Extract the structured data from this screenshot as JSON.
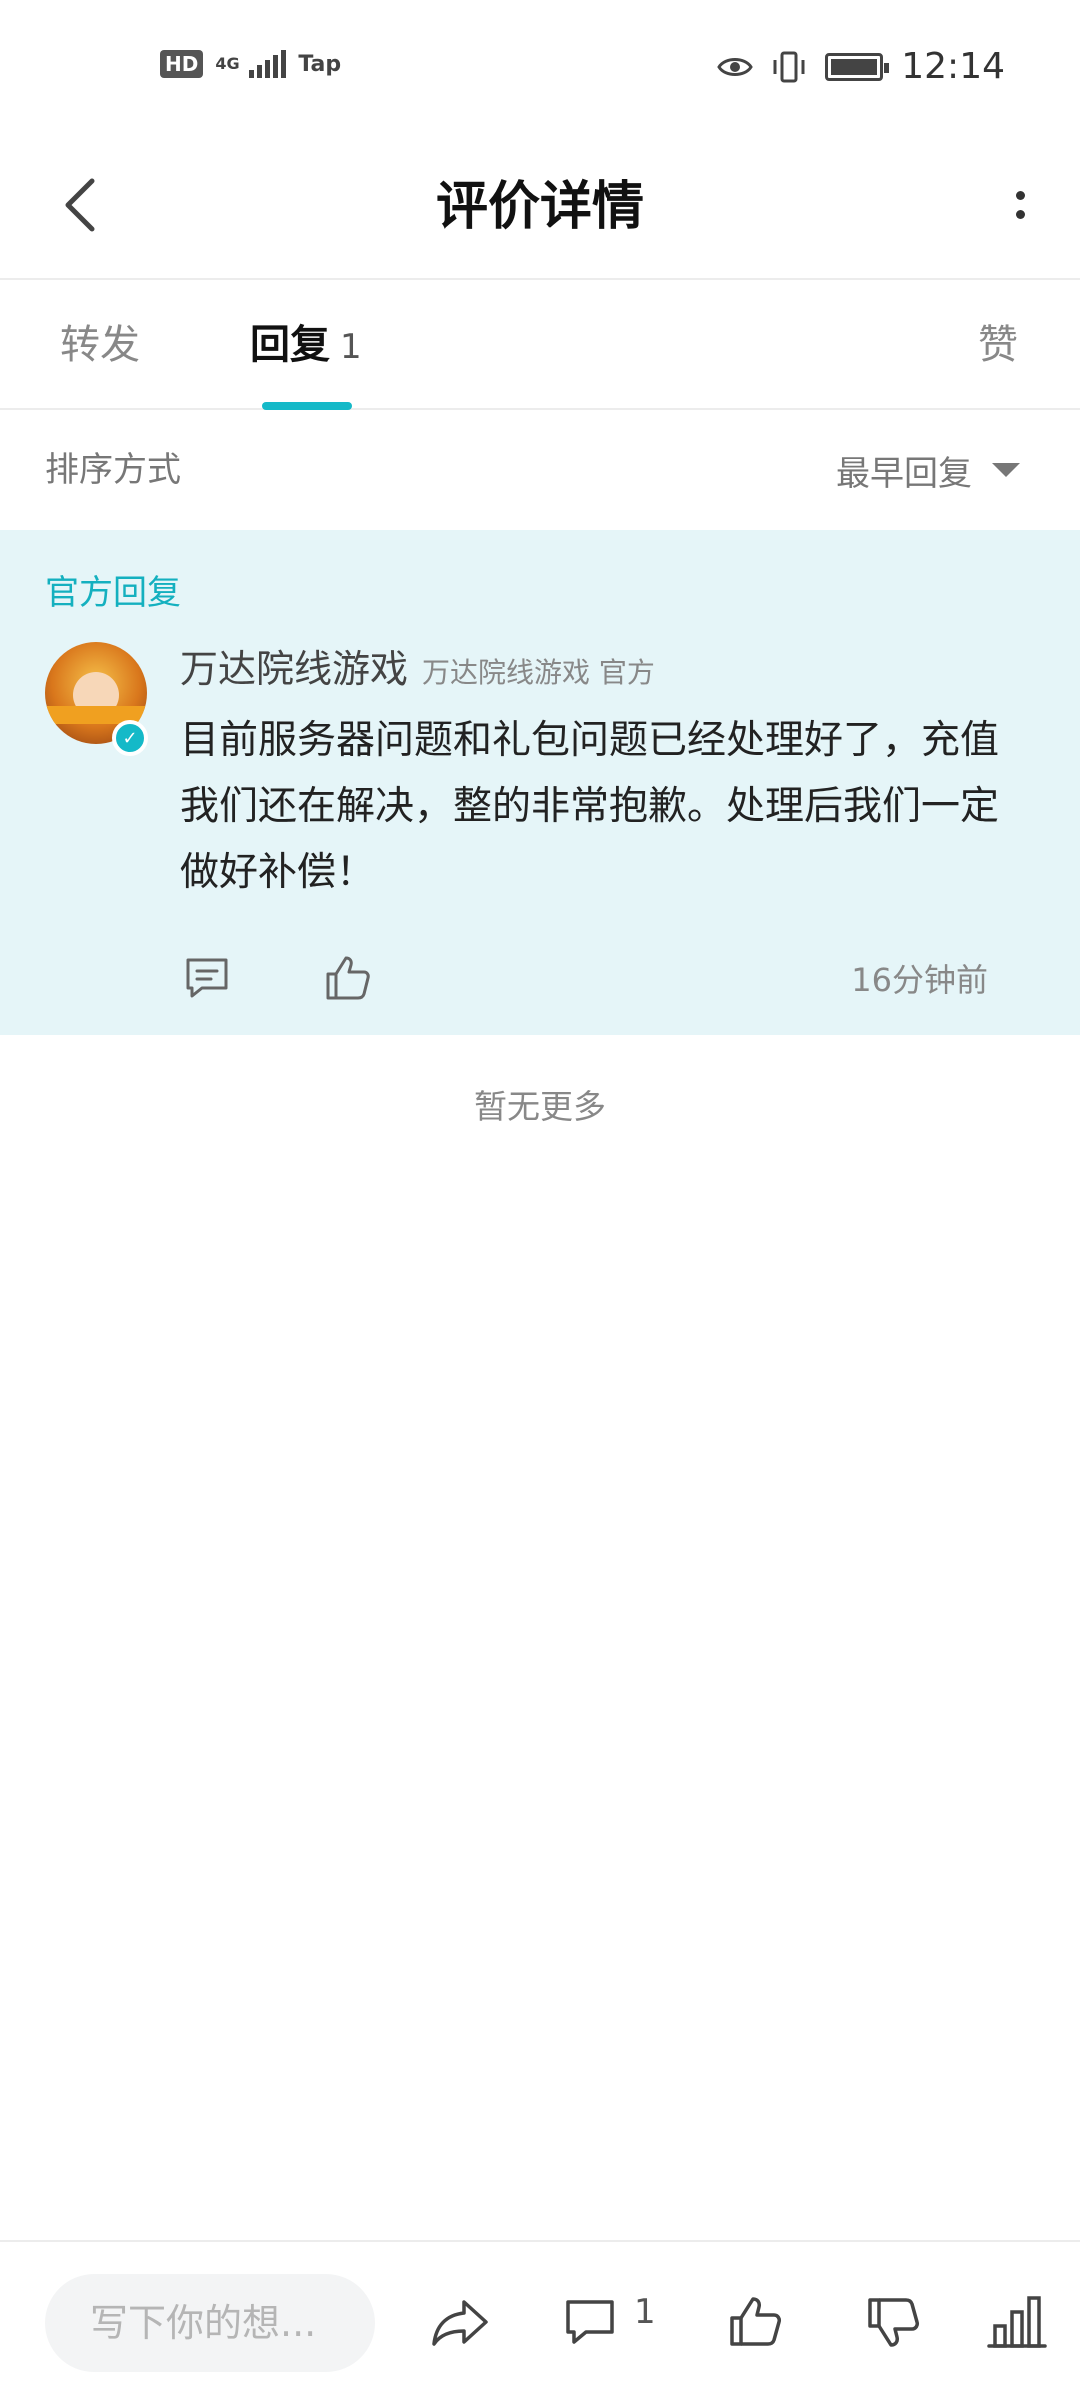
{
  "status_bar": {
    "hd": "HD",
    "network": "4G",
    "carrier": "Tap",
    "time": "12:14",
    "icons": [
      "eye-icon",
      "vibrate-icon",
      "battery-icon"
    ]
  },
  "header": {
    "title": "评价详情",
    "back_icon": "chevron-left-icon",
    "more_icon": "more-vertical-icon"
  },
  "tabs": [
    {
      "label": "转发"
    },
    {
      "label": "回复",
      "count": "1",
      "active": true
    },
    {
      "label": "赞"
    }
  ],
  "sort": {
    "label": "排序方式",
    "selected": "最早回复"
  },
  "official_reply": {
    "section_label": "官方回复",
    "author_name": "万达院线游戏",
    "author_sub": "万达院线游戏 官方",
    "text": "目前服务器问题和礼包问题已经处理好了，充值我们还在解决，整的非常抱歉。处理后我们一定做好补偿！",
    "time": "16分钟前"
  },
  "list_end": "暂无更多",
  "bottom_bar": {
    "input_placeholder": "写下你的想...",
    "comment_count": "1"
  },
  "colors": {
    "accent": "#14b9c8",
    "official_bg": "#e5f5f8"
  }
}
